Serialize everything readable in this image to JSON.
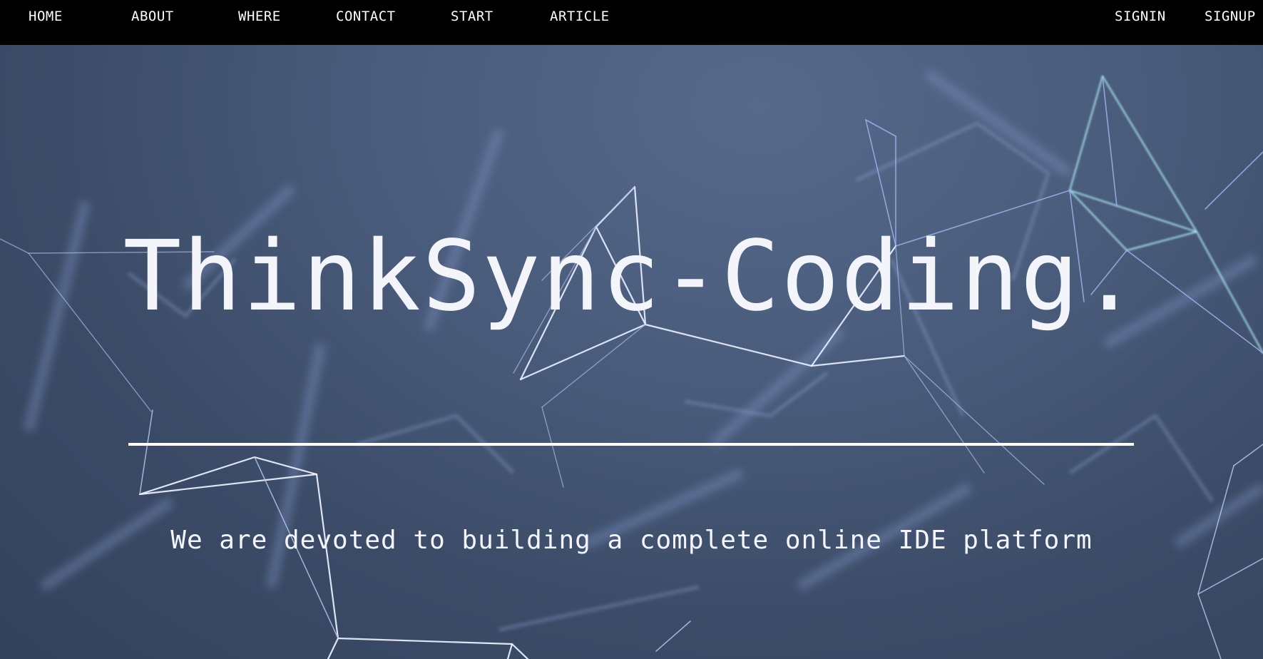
{
  "nav": {
    "left_items": [
      {
        "label": "HOME"
      },
      {
        "label": "ABOUT"
      },
      {
        "label": "WHERE"
      },
      {
        "label": "CONTACT"
      },
      {
        "label": "START"
      },
      {
        "label": "ARTICLE"
      }
    ],
    "right_items": [
      {
        "label": "SIGNIN"
      },
      {
        "label": "SIGNUP"
      }
    ]
  },
  "hero": {
    "title": "ThinkSync-Coding.",
    "subtitle": "We are devoted to building a complete online IDE platform"
  },
  "colors": {
    "navbar_bg": "#000000",
    "hero_bg": "#4a5c7c",
    "text": "#f4f5fa"
  }
}
